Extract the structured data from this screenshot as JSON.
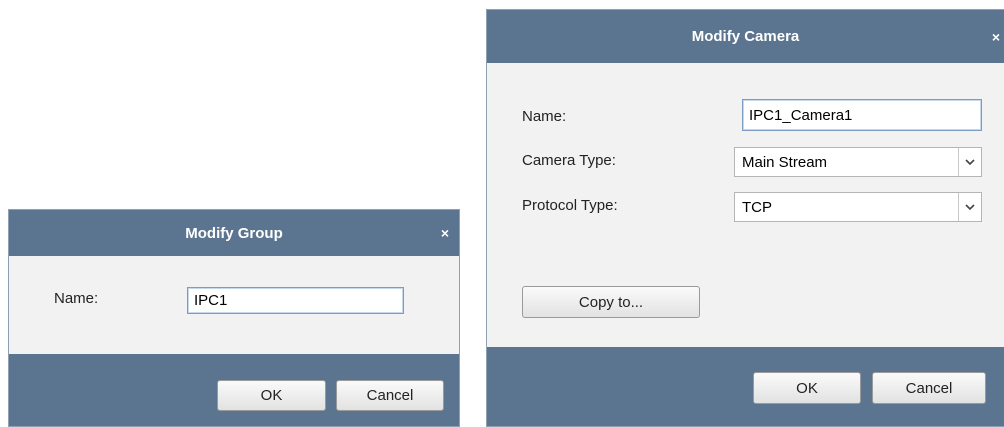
{
  "group_dialog": {
    "title": "Modify Group",
    "close_glyph": "×",
    "name_label": "Name:",
    "name_value": "IPC1",
    "ok_label": "OK",
    "cancel_label": "Cancel"
  },
  "camera_dialog": {
    "title": "Modify Camera",
    "close_glyph": "×",
    "name_label": "Name:",
    "name_value": "IPC1_Camera1",
    "camera_type_label": "Camera Type:",
    "camera_type_value": "Main Stream",
    "protocol_type_label": "Protocol Type:",
    "protocol_type_value": "TCP",
    "copy_to_label": "Copy to...",
    "ok_label": "OK",
    "cancel_label": "Cancel"
  },
  "icons": {
    "close": "close-icon",
    "dropdown": "chevron-down-icon"
  },
  "colors": {
    "titlebar": "#5b7590",
    "body": "#f2f2f2",
    "input_border": "#7d9cc2"
  }
}
